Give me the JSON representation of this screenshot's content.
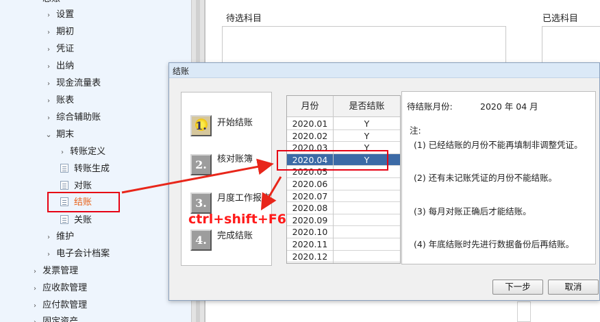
{
  "nav": {
    "partial_top": "总账",
    "items": [
      {
        "label": "设置",
        "arrow": "›"
      },
      {
        "label": "期初",
        "arrow": "›"
      },
      {
        "label": "凭证",
        "arrow": "›"
      },
      {
        "label": "出纳",
        "arrow": "›"
      },
      {
        "label": "现金流量表",
        "arrow": "›"
      },
      {
        "label": "账表",
        "arrow": "›"
      },
      {
        "label": "综合辅助账",
        "arrow": "›"
      },
      {
        "label": "期末",
        "arrow": "⌄"
      },
      {
        "label": "转账定义",
        "arrow": "›"
      },
      {
        "label": "转账生成"
      },
      {
        "label": "对账"
      },
      {
        "label": "结账"
      },
      {
        "label": "关账"
      },
      {
        "label": "维护",
        "arrow": "›"
      },
      {
        "label": "电子会计档案",
        "arrow": "›"
      },
      {
        "label": "发票管理",
        "arrow": "›"
      },
      {
        "label": "应收款管理",
        "arrow": "›"
      },
      {
        "label": "应付款管理",
        "arrow": "›"
      },
      {
        "label": "固定资产",
        "arrow": "›"
      }
    ]
  },
  "main": {
    "pending_subjects_label": "待选科目",
    "selected_subjects_label": "已选科目"
  },
  "dialog": {
    "title": "结账",
    "steps": [
      {
        "number": "1.",
        "label": "开始结账"
      },
      {
        "number": "2.",
        "label": "核对账簿"
      },
      {
        "number": "3.",
        "label": "月度工作报告"
      },
      {
        "number": "4.",
        "label": "完成结账"
      }
    ],
    "table": {
      "headers": [
        "月份",
        "是否结账"
      ],
      "rows": [
        {
          "month": "2020.01",
          "closed": "Y"
        },
        {
          "month": "2020.02",
          "closed": "Y"
        },
        {
          "month": "2020.03",
          "closed": "Y"
        },
        {
          "month": "2020.04",
          "closed": "Y"
        },
        {
          "month": "2020.05",
          "closed": ""
        },
        {
          "month": "2020.06",
          "closed": ""
        },
        {
          "month": "2020.07",
          "closed": ""
        },
        {
          "month": "2020.08",
          "closed": ""
        },
        {
          "month": "2020.09",
          "closed": ""
        },
        {
          "month": "2020.10",
          "closed": ""
        },
        {
          "month": "2020.11",
          "closed": ""
        },
        {
          "month": "2020.12",
          "closed": ""
        }
      ],
      "selected_month": "2020.04"
    },
    "notes": {
      "pending_label": "待结账月份:",
      "pending_value": "2020 年 04 月",
      "heading": "注:",
      "items": [
        "(1) 已经结账的月份不能再填制非调整凭证。",
        "(2) 还有未记账凭证的月份不能结账。",
        "(3) 每月对账正确后才能结账。",
        "(4) 年底结账时先进行数据备份后再结账。"
      ]
    },
    "buttons": {
      "next": "下一步",
      "cancel": "取消"
    }
  },
  "annotation": {
    "shortcut": "ctrl+shift+F6",
    "color": "#e60012"
  }
}
